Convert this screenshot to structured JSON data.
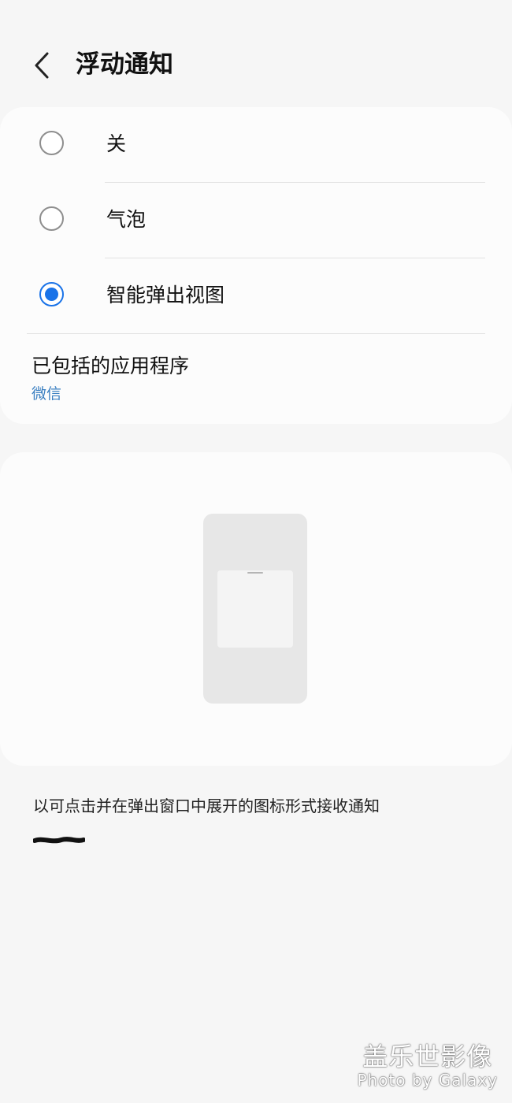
{
  "header": {
    "title": "浮动通知",
    "back_icon": "chevron-left-icon"
  },
  "options": [
    {
      "label": "关",
      "checked": false
    },
    {
      "label": "气泡",
      "checked": false
    },
    {
      "label": "智能弹出视图",
      "checked": true
    }
  ],
  "included_apps": {
    "title": "已包括的应用程序",
    "value": "微信"
  },
  "preview": {
    "illustration": "phone-popup-illustration"
  },
  "description": "以可点击并在弹出窗口中展开的图标形式接收通知",
  "watermark": {
    "main": "盖乐世影像",
    "sub": "Photo by Galaxy"
  },
  "colors": {
    "accent": "#1a73e8",
    "link": "#3a7fc1",
    "background": "#f6f6f6",
    "card": "#fcfcfc"
  }
}
